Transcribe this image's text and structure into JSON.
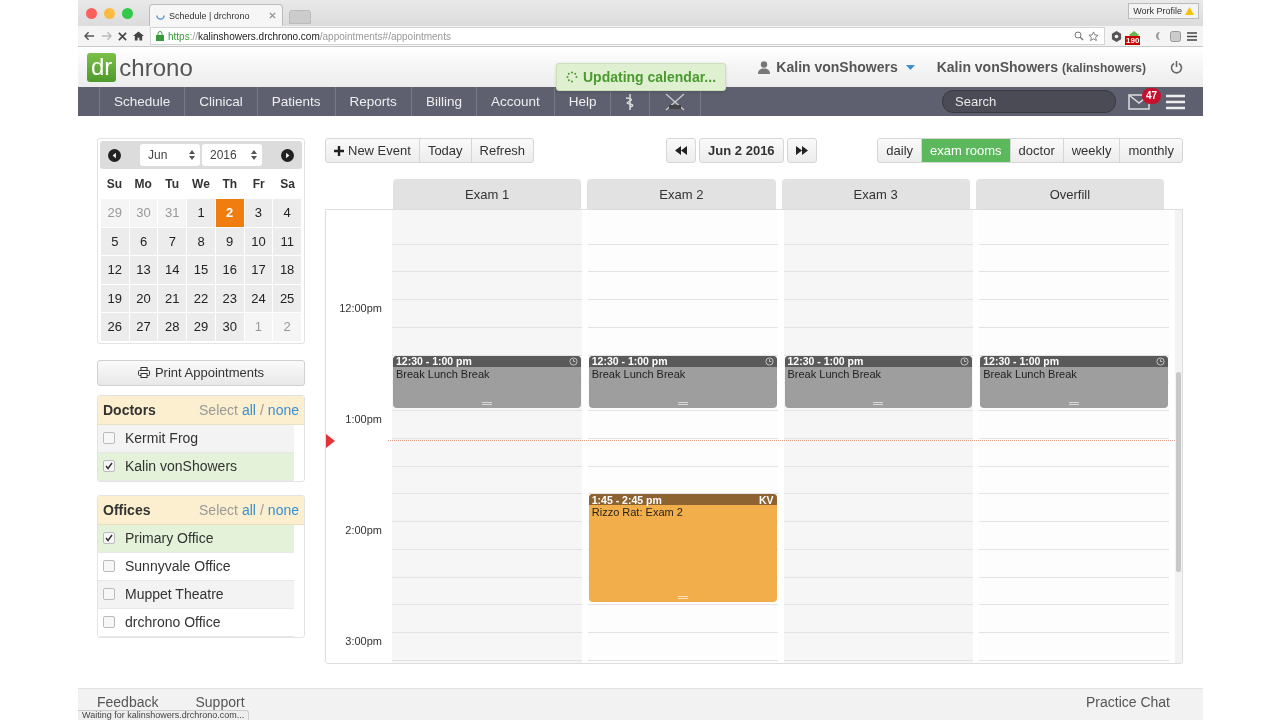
{
  "browser": {
    "tab_title": "Schedule | drchrono",
    "profile": "Work Profile",
    "url": "https://kalinshowers.drchrono.com/appointments#/appointments",
    "extension_badge": "190",
    "status": "Waiting for kalinshowers.drchrono.com..."
  },
  "header": {
    "logo_mark": "dr",
    "logo_word": "chrono",
    "notice": "Updating calendar...",
    "user_menu": "Kalin vonShowers",
    "account_name": "Kalin vonShowers",
    "account_username": "(kalinshowers)"
  },
  "nav": {
    "items": [
      "Schedule",
      "Clinical",
      "Patients",
      "Reports",
      "Billing",
      "Account",
      "Help"
    ],
    "search": {
      "placeholder": "Search"
    },
    "mail_count": "47"
  },
  "mini_calendar": {
    "month": "Jun",
    "year": "2016",
    "weekdays": [
      "Su",
      "Mo",
      "Tu",
      "We",
      "Th",
      "Fr",
      "Sa"
    ],
    "days": [
      {
        "day": "29",
        "in_month": false,
        "selected": false
      },
      {
        "day": "30",
        "in_month": false,
        "selected": false
      },
      {
        "day": "31",
        "in_month": false,
        "selected": false
      },
      {
        "day": "1",
        "in_month": true,
        "selected": false
      },
      {
        "day": "2",
        "in_month": true,
        "selected": true
      },
      {
        "day": "3",
        "in_month": true,
        "selected": false
      },
      {
        "day": "4",
        "in_month": true,
        "selected": false
      },
      {
        "day": "5",
        "in_month": true,
        "selected": false
      },
      {
        "day": "6",
        "in_month": true,
        "selected": false
      },
      {
        "day": "7",
        "in_month": true,
        "selected": false
      },
      {
        "day": "8",
        "in_month": true,
        "selected": false
      },
      {
        "day": "9",
        "in_month": true,
        "selected": false
      },
      {
        "day": "10",
        "in_month": true,
        "selected": false
      },
      {
        "day": "11",
        "in_month": true,
        "selected": false
      },
      {
        "day": "12",
        "in_month": true,
        "selected": false
      },
      {
        "day": "13",
        "in_month": true,
        "selected": false
      },
      {
        "day": "14",
        "in_month": true,
        "selected": false
      },
      {
        "day": "15",
        "in_month": true,
        "selected": false
      },
      {
        "day": "16",
        "in_month": true,
        "selected": false
      },
      {
        "day": "17",
        "in_month": true,
        "selected": false
      },
      {
        "day": "18",
        "in_month": true,
        "selected": false
      },
      {
        "day": "19",
        "in_month": true,
        "selected": false
      },
      {
        "day": "20",
        "in_month": true,
        "selected": false
      },
      {
        "day": "21",
        "in_month": true,
        "selected": false
      },
      {
        "day": "22",
        "in_month": true,
        "selected": false
      },
      {
        "day": "23",
        "in_month": true,
        "selected": false
      },
      {
        "day": "24",
        "in_month": true,
        "selected": false
      },
      {
        "day": "25",
        "in_month": true,
        "selected": false
      },
      {
        "day": "26",
        "in_month": true,
        "selected": false
      },
      {
        "day": "27",
        "in_month": true,
        "selected": false
      },
      {
        "day": "28",
        "in_month": true,
        "selected": false
      },
      {
        "day": "29",
        "in_month": true,
        "selected": false
      },
      {
        "day": "30",
        "in_month": true,
        "selected": false
      },
      {
        "day": "1",
        "in_month": false,
        "selected": false
      },
      {
        "day": "2",
        "in_month": false,
        "selected": false
      }
    ]
  },
  "print_button": "Print Appointments",
  "filters": [
    {
      "title": "Doctors",
      "select_label": "Select",
      "all_link": "all",
      "separator": "/",
      "none_link": "none",
      "items": [
        {
          "label": "Kermit Frog",
          "checked": false
        },
        {
          "label": "Kalin vonShowers",
          "checked": true
        }
      ]
    },
    {
      "title": "Offices",
      "select_label": "Select",
      "all_link": "all",
      "separator": "/",
      "none_link": "none",
      "items": [
        {
          "label": "Primary Office",
          "checked": true
        },
        {
          "label": "Sunnyvale Office",
          "checked": false
        },
        {
          "label": "Muppet Theatre",
          "checked": false
        },
        {
          "label": "drchrono Office",
          "checked": false
        }
      ]
    }
  ],
  "toolbar": {
    "actions": [
      "New Event",
      "Today",
      "Refresh"
    ],
    "date": "Jun 2 2016",
    "views": [
      {
        "label": "daily",
        "selected": false
      },
      {
        "label": "exam rooms",
        "selected": true
      },
      {
        "label": "doctor",
        "selected": false
      },
      {
        "label": "weekly",
        "selected": false
      },
      {
        "label": "monthly",
        "selected": false
      }
    ]
  },
  "calendar": {
    "time_labels": [
      "12:00pm",
      "1:00pm",
      "2:00pm",
      "3:00pm"
    ],
    "columns": [
      {
        "name": "Exam 1",
        "events": [
          {
            "kind": "break",
            "time": "12:30 - 1:00 pm",
            "title": "Break Lunch Break"
          }
        ]
      },
      {
        "name": "Exam 2",
        "events": [
          {
            "kind": "break",
            "time": "12:30 - 1:00 pm",
            "title": "Break Lunch Break"
          },
          {
            "kind": "appointment",
            "time": "1:45 - 2:45 pm",
            "title": "Rizzo Rat: Exam 2",
            "initials": "KV"
          }
        ]
      },
      {
        "name": "Exam 3",
        "events": [
          {
            "kind": "break",
            "time": "12:30 - 1:00 pm",
            "title": "Break Lunch Break"
          }
        ]
      },
      {
        "name": "Overfill",
        "events": [
          {
            "kind": "break",
            "time": "12:30 - 1:00 pm",
            "title": "Break Lunch Break"
          }
        ]
      }
    ]
  },
  "footer": {
    "links": [
      "Feedback",
      "Support"
    ],
    "chat": "Practice Chat"
  }
}
